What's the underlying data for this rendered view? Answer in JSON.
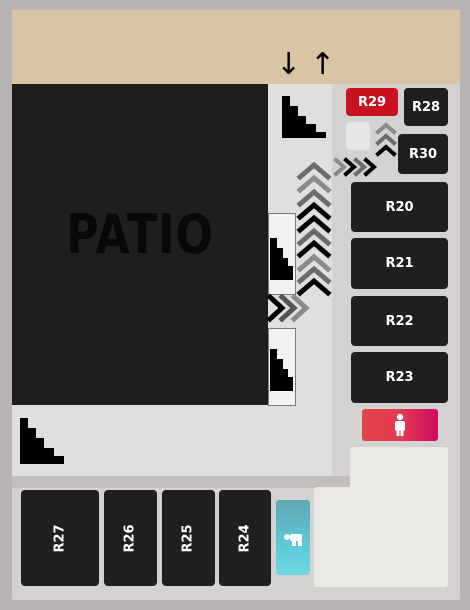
{
  "map": {
    "area_label": "PATIO",
    "direction_arrows": {
      "down": "↓",
      "up": "↑"
    },
    "rooms_right": [
      {
        "label": "R29",
        "color": "#c8121f"
      },
      {
        "label": "R28",
        "color": "#1f1f1f"
      },
      {
        "label": "R30",
        "color": "#1f1f1f"
      },
      {
        "label": "R20",
        "color": "#1f1f1f"
      },
      {
        "label": "R21",
        "color": "#1f1f1f"
      },
      {
        "label": "R22",
        "color": "#1f1f1f"
      },
      {
        "label": "R23",
        "color": "#1f1f1f"
      }
    ],
    "rooms_bottom": [
      {
        "label": "R27"
      },
      {
        "label": "R26"
      },
      {
        "label": "R25"
      },
      {
        "label": "R24"
      }
    ],
    "icons": [
      "stairs-icon",
      "restroom-icon",
      "accessible-restroom-icon",
      "chevron-path-icon"
    ],
    "colors": {
      "patio": "#1e1e1e",
      "highlight_room": "#c8121f",
      "restroom": "#e23a53",
      "accessible": "#5fc7d6",
      "terrace": "#d9c4a3"
    }
  }
}
